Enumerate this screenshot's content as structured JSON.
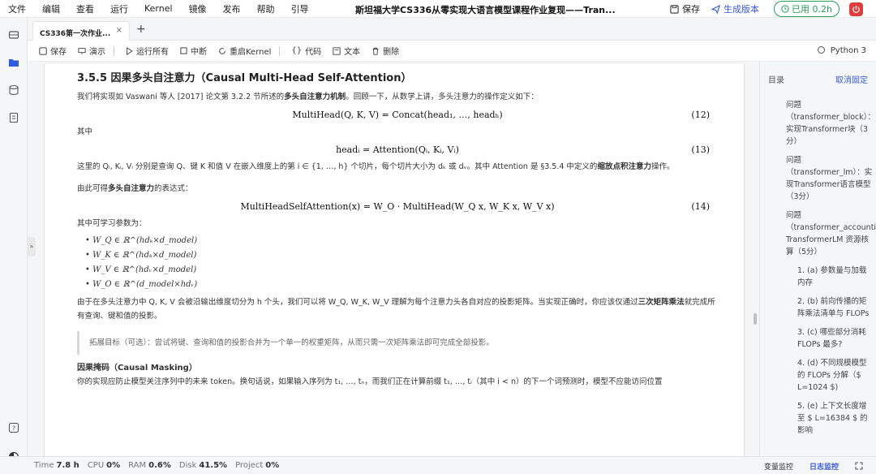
{
  "menubar": {
    "items": [
      "文件",
      "编辑",
      "查看",
      "运行",
      "Kernel",
      "镜像",
      "发布",
      "帮助",
      "引导"
    ],
    "title": "斯坦福大学CS336从零实现大语言模型课程作业复现——Tran...",
    "save_label": "保存",
    "publish_label": "生成版本",
    "used_label": "已用 0.2h"
  },
  "tabs": {
    "active_label": "CS336第一次作业...",
    "close": "×",
    "new": "+"
  },
  "toolbar": {
    "save": "保存",
    "present": "演示",
    "run_all": "运行所有",
    "interrupt": "中断",
    "restart": "重启Kernel",
    "code": "代码",
    "text": "文本",
    "delete": "删除",
    "kernel": "Python 3"
  },
  "cell": {
    "heading": "3.5.5 因果多头自注意力（Causal Multi-Head Self-Attention）",
    "p1_a": "我们将实现如 Vaswani 等人 [2017] 论文第 3.2.2 节所述的",
    "p1_bold": "多头自注意力机制",
    "p1_b": "。回顾一下，从数学上讲，多头注意力的操作定义如下：",
    "eq12": "MultiHead(Q, K, V) = Concat(head₁, …, headₕ)",
    "eq12_num": "(12)",
    "where": "其中",
    "eq13": "headᵢ = Attention(Qᵢ, Kᵢ, Vᵢ)",
    "eq13_num": "(13)",
    "p2_a": "这里的 Qᵢ, Kᵢ, Vᵢ 分别是查询 Q、键 K 和值 V 在嵌入维度上的第 i ∈ {1, …, h} 个切片，每个切片大小为 dₖ 或 dᵥ。其中 Attention 是 §3.5.4 中定义的",
    "p2_bold": "缩放点积注意力",
    "p2_b": "操作。",
    "p3_a": "由此可得",
    "p3_bold": "多头自注意力",
    "p3_b": "的表达式：",
    "eq14": "MultiHeadSelfAttention(x) = W_O · MultiHead(W_Q x, W_K x, W_V x)",
    "eq14_num": "(14)",
    "params": "其中可学习参数为：",
    "bullets": [
      "W_Q ∈ ℝ^(hdₖ×d_model)",
      "W_K ∈ ℝ^(hdₖ×d_model)",
      "W_V ∈ ℝ^(hdᵥ×d_model)",
      "W_O ∈ ℝ^(d_model×hdᵥ)"
    ],
    "p4_a": "由于在多头注意力中 Q, K, V 会被沿输出维度切分为 h 个头，我们可以将 W_Q, W_K, W_V 理解为每个注意力头各自对应的投影矩阵。当实现正确时，你应该仅通过",
    "p4_bold": "三次矩阵乘法",
    "p4_b": "就完成所有查询、键和值的投影。",
    "quote": "拓展目标（可选）：尝试将键、查询和值的投影合并为一个单一的权重矩阵，从而只需一次矩阵乘法即可完成全部投影。",
    "subheading": "因果掩码（Causal Masking）",
    "p5": "你的实现应防止模型关注序列中的未来 token。换句话说，如果输入序列为 t₁, …, tₙ，而我们正在计算前缀 t₁, …, tᵢ（其中 i < n）的下一个词预测时，模型不应能访问位置"
  },
  "toc": {
    "title": "目录",
    "collapse": "取消固定",
    "items": [
      {
        "text": "问题（transformer_block）：实现Transformer块（3分）",
        "level": 1
      },
      {
        "text": "问题（transformer_lm）：实现Transformer语言模型（3分）",
        "level": 1
      },
      {
        "text": "问题（transformer_accounting）：TransformerLM 资源核算（5分）",
        "level": 1
      },
      {
        "text": "1. (a) 参数量与加载内存",
        "level": 2
      },
      {
        "text": "2. (b) 前向传播的矩阵乘法清单与 FLOPs",
        "level": 2
      },
      {
        "text": "3. (c) 哪些部分消耗 FLOPs 最多?",
        "level": 2
      },
      {
        "text": "4. (d) 不同规模模型的 FLOPs 分解（$ L=1024 $)",
        "level": 2
      },
      {
        "text": "5. (e) 上下文长度增至 $ L=16384 $ 的影响",
        "level": 2
      }
    ]
  },
  "status": {
    "time_label": "Time",
    "time": "7.8 h",
    "cpu_label": "CPU",
    "cpu": "0%",
    "ram_label": "RAM",
    "ram": "0.6%",
    "disk_label": "Disk",
    "disk": "41.5%",
    "project_label": "Project",
    "project": "0%",
    "var_monitor": "变量监控",
    "log_monitor": "日志监控"
  }
}
